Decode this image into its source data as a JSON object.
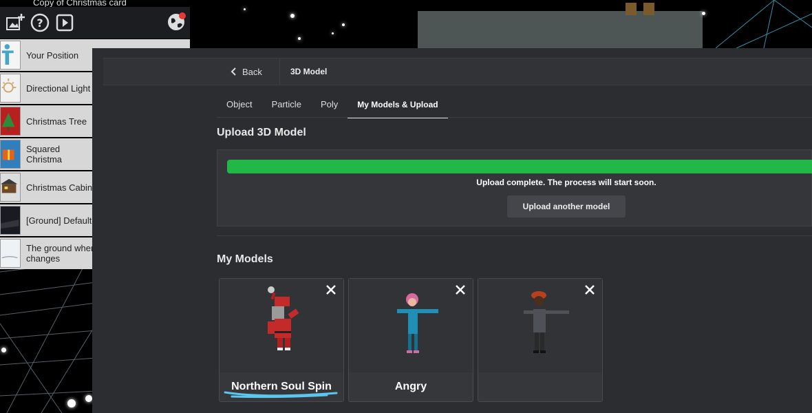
{
  "top_caption": "Copy of Christmas card",
  "toolbar": {
    "icons": [
      "add-image-icon",
      "help-icon",
      "play-icon",
      "globe-icon"
    ]
  },
  "scene_list": [
    {
      "label": "Your Position",
      "icon": "person-icon",
      "color": "#46a6c7"
    },
    {
      "label": "Directional Light",
      "icon": "light-icon",
      "color": "#f1f1f1"
    },
    {
      "label": "Christmas Tree",
      "icon": "tree-icon",
      "color": "#b82020"
    },
    {
      "label": "Squared Christma",
      "icon": "gift-icon",
      "color": "#2f7fbf"
    },
    {
      "label": "Christmas Cabin",
      "icon": "cabin-icon",
      "color": "#6b4a2a"
    },
    {
      "label": "[Ground] Default",
      "icon": "ground-icon",
      "color": "#1a1a22"
    },
    {
      "label": "The ground wher changes",
      "icon": "ground-change-icon",
      "color": "#eef2f5"
    }
  ],
  "header": {
    "back_label": "Back",
    "title": "3D Model"
  },
  "tabs": [
    {
      "label": "Object",
      "active": false
    },
    {
      "label": "Particle",
      "active": false
    },
    {
      "label": "Poly",
      "active": false
    },
    {
      "label": "My Models & Upload",
      "active": true
    }
  ],
  "upload": {
    "title": "Upload 3D Model",
    "progress_percent": 100,
    "status": "Upload complete. The process will start soon.",
    "another_label": "Upload another model",
    "bar_color": "#22b847"
  },
  "my_models": {
    "title": "My Models",
    "items": [
      {
        "name": "Northern Soul Spin",
        "figure": "santa"
      },
      {
        "name": "Angry",
        "figure": "blue-character"
      },
      {
        "name": "",
        "figure": "cap-character"
      }
    ]
  }
}
